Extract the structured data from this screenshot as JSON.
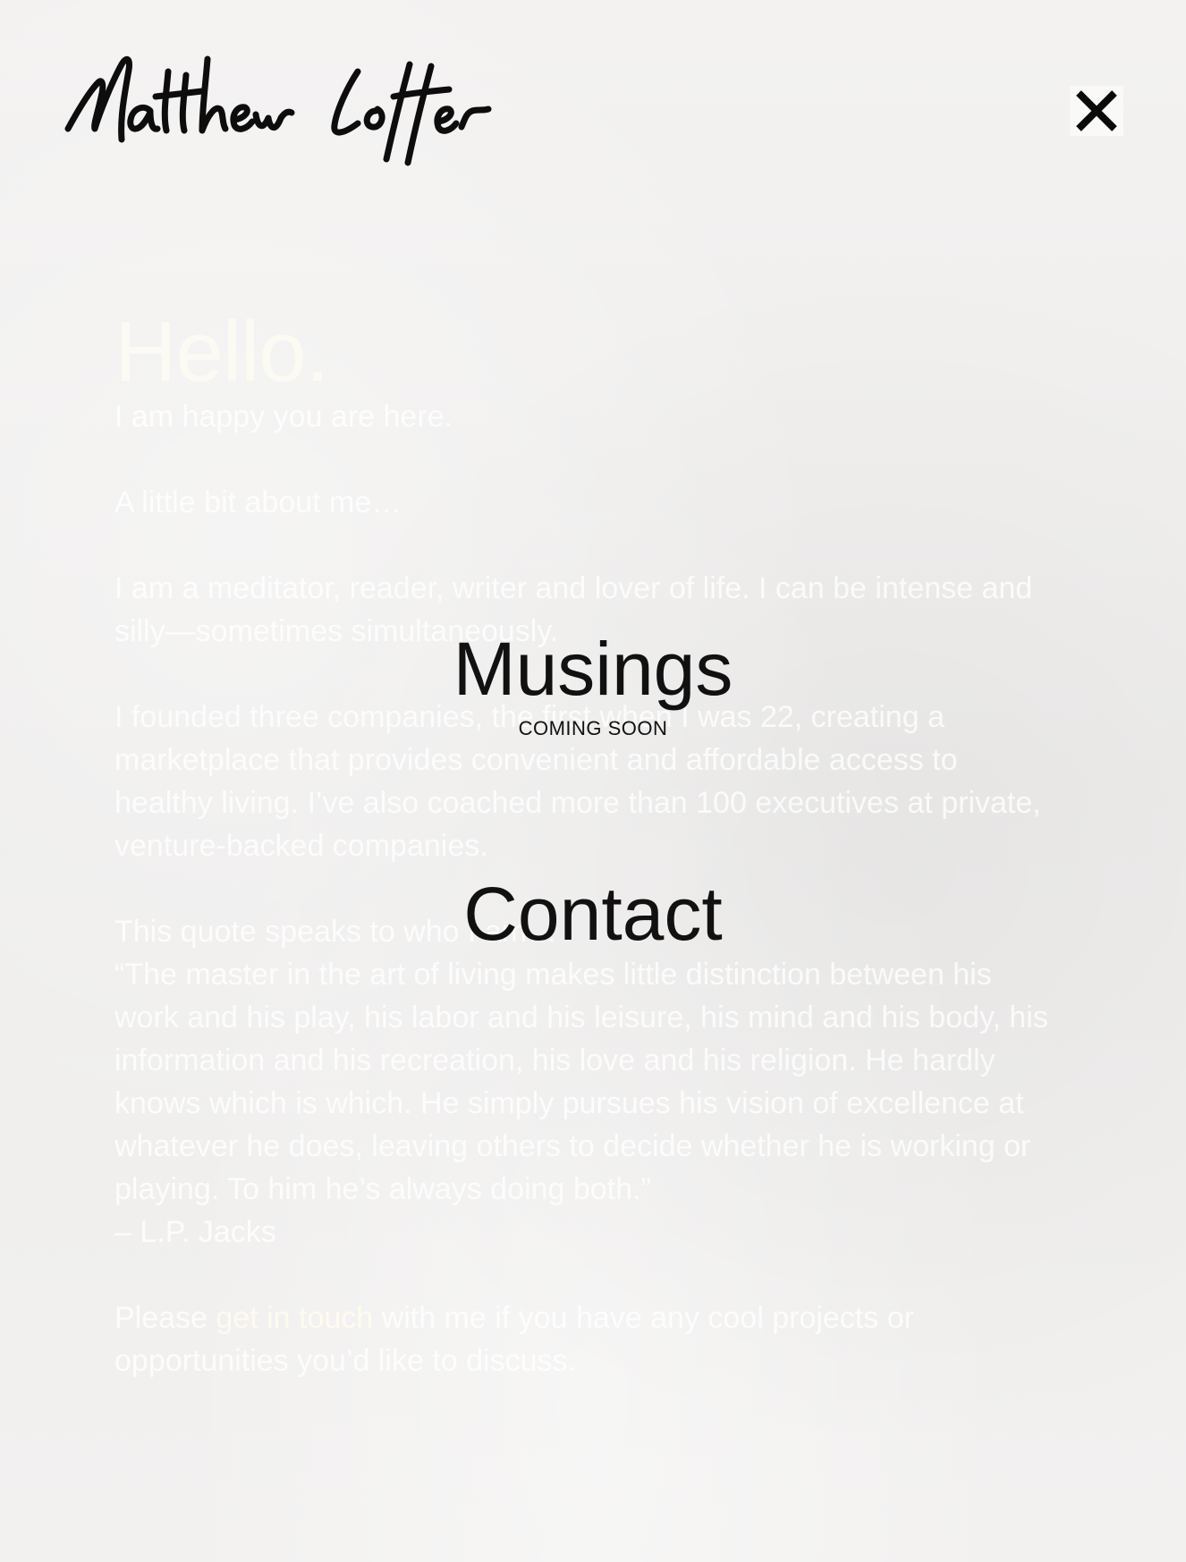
{
  "header": {
    "logo_text": "Matthew Loffer",
    "close_icon": "close-icon"
  },
  "about": {
    "heading": "Hello.",
    "intro": "I am happy you are here.",
    "subheading": "A little bit about me…",
    "paragraph_1": "I am a meditator, reader, writer and lover of life. I can be intense and silly—sometimes simultaneously.",
    "paragraph_2": "I founded three companies, the first when I was 22, creating a marketplace that provides  convenient and affordable access to healthy living. I’ve also coached more than 100 executives at private, venture-backed companies.",
    "quote_intro": "This quote speaks to who I am…",
    "quote": "“The master in the art of living makes little distinction between his work and his play, his labor and his leisure, his mind and his body, his information and his recreation, his love and his religion. He hardly knows which is which. He simply pursues his vision of excellence at whatever he does, leaving others to decide whether he is working or playing. To him he’s always doing both.”",
    "quote_author": "– L.P. Jacks",
    "closing_before": "Please ",
    "closing_link": "get in touch",
    "closing_after": " with me if you have any cool projects or opportunities you’d like to discuss."
  },
  "menu": {
    "musings_label": "Musings",
    "musings_status": "COMING SOON",
    "contact_label": "Contact"
  },
  "colors": {
    "background": "#f1f0ef",
    "menu_text": "#111111",
    "faded_text": "#ffffff"
  }
}
